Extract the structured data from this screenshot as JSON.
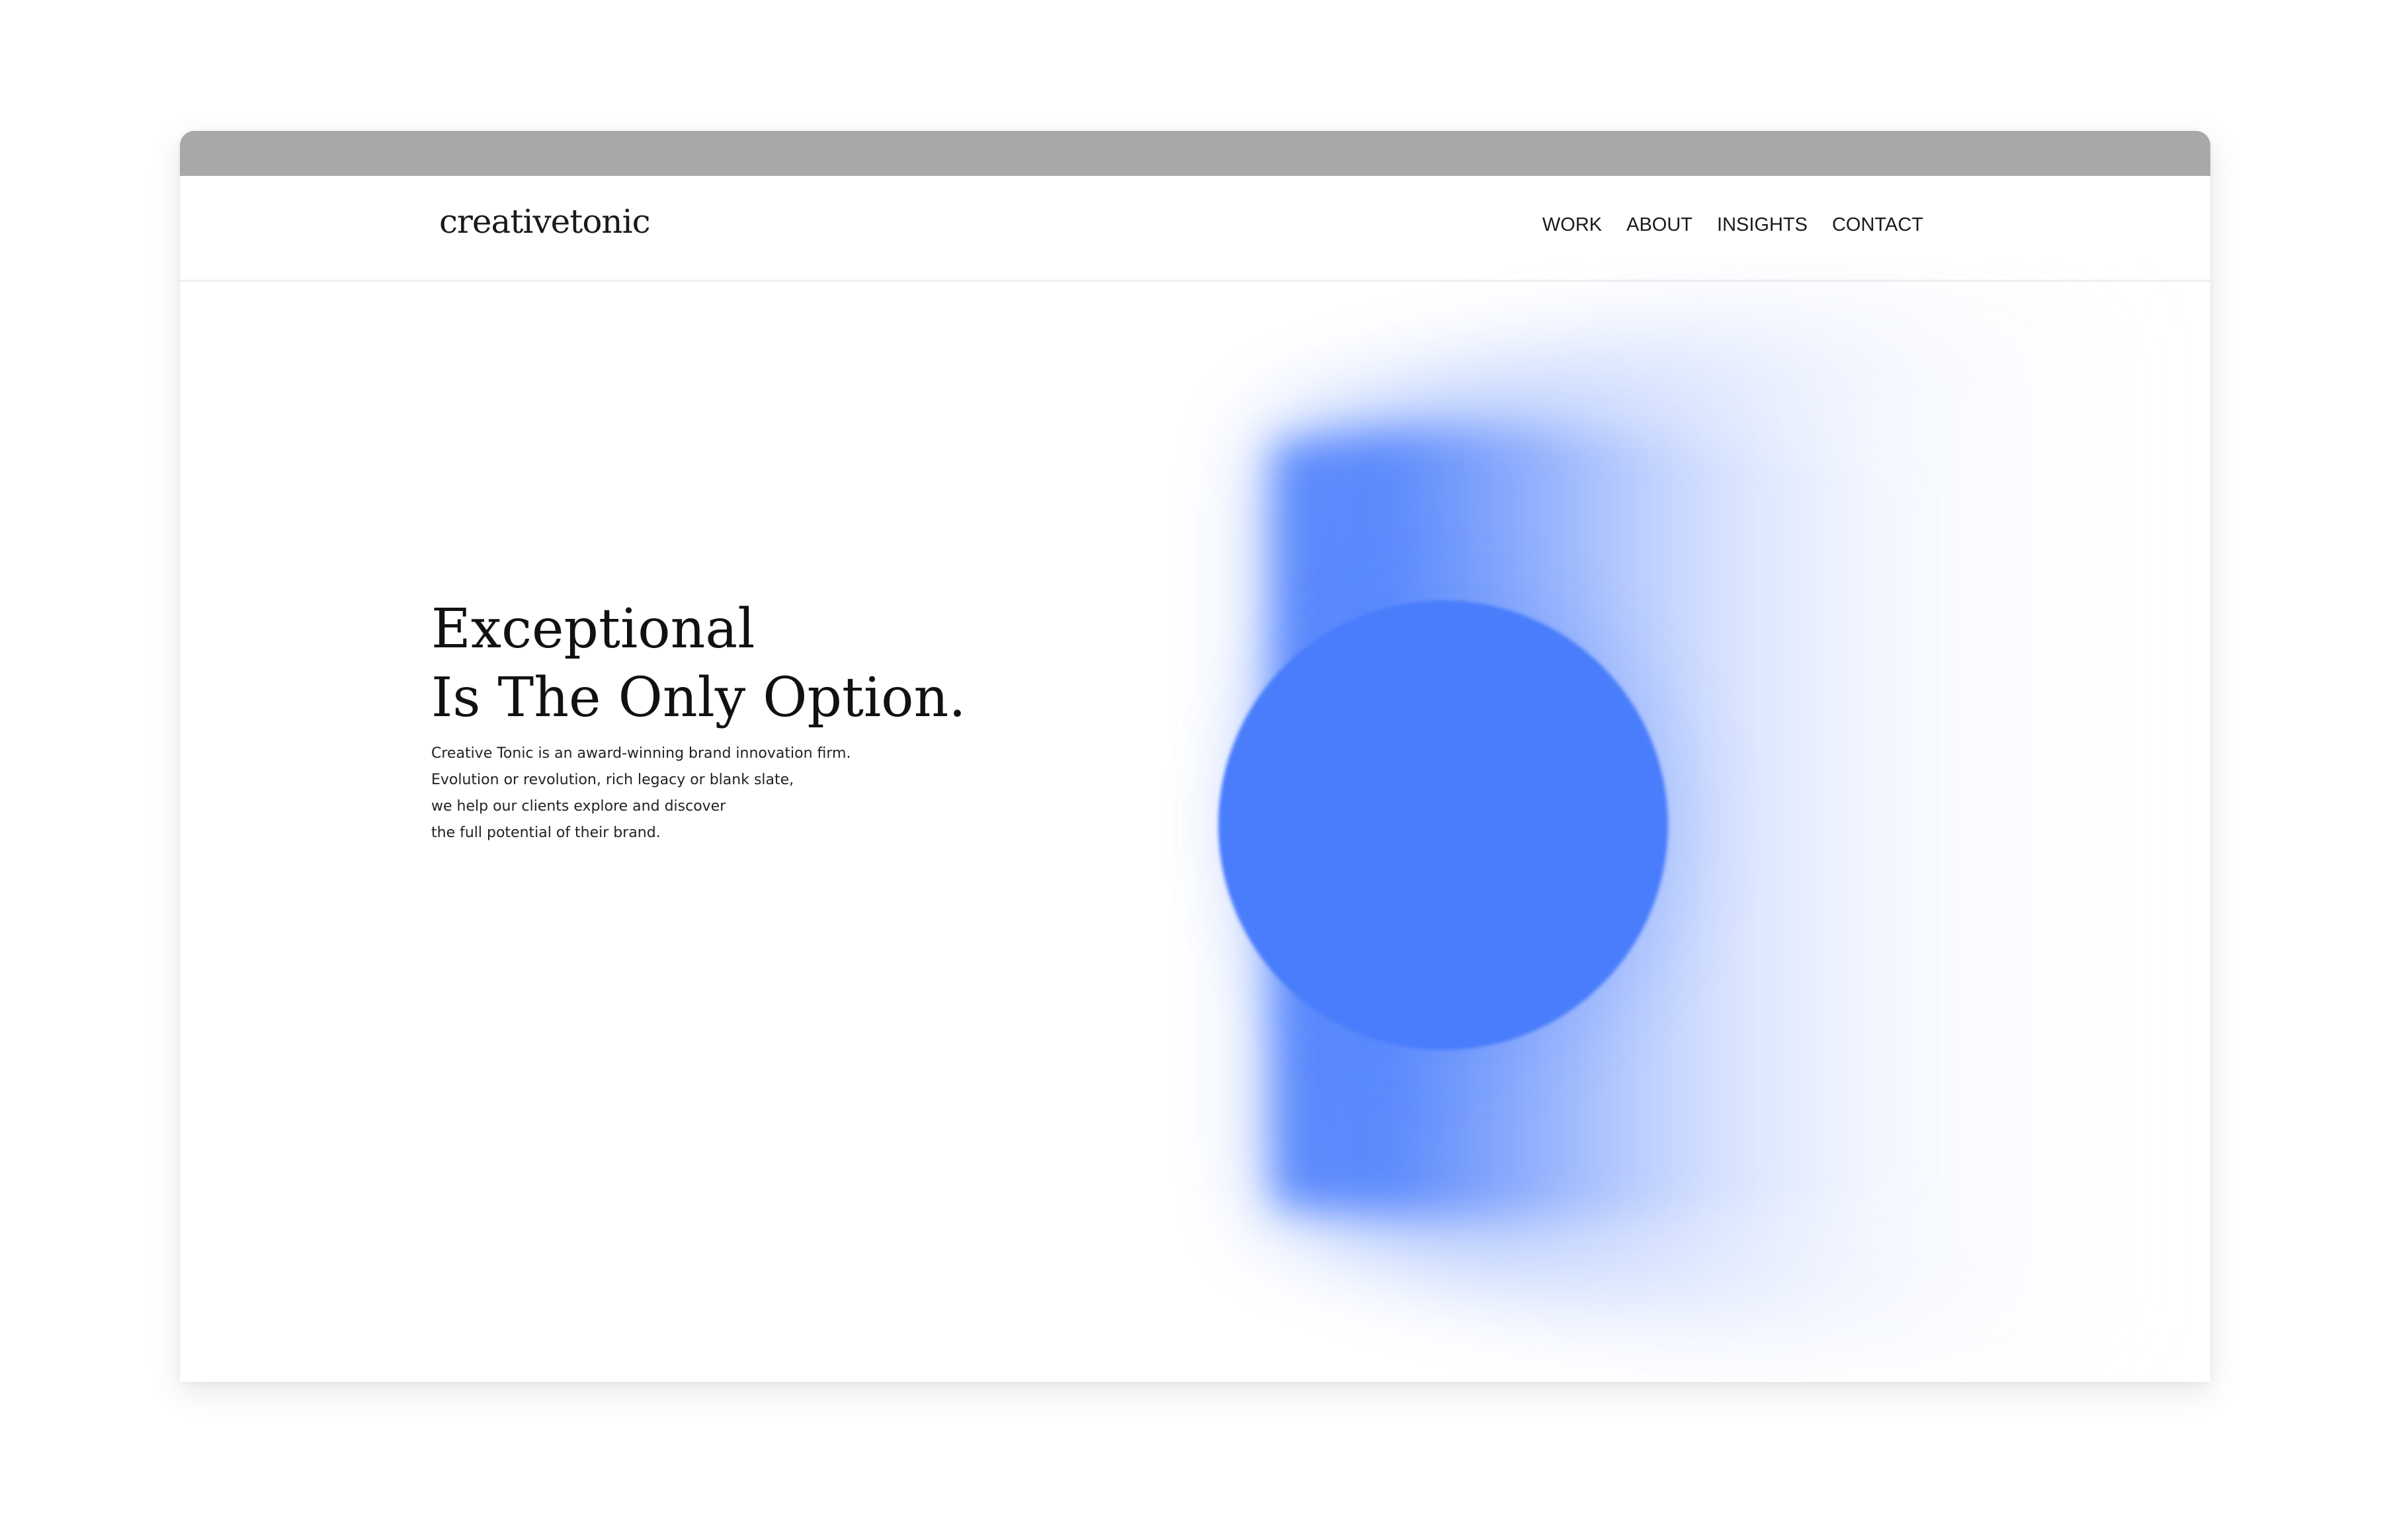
{
  "brand": {
    "logo": "creativetonic"
  },
  "nav": {
    "items": [
      "WORK",
      "ABOUT",
      "INSIGHTS",
      "CONTACT"
    ]
  },
  "hero": {
    "headline": [
      "Exceptional",
      "Is The Only Option."
    ],
    "body_lines": [
      "Creative Tonic is an award-winning brand innovation firm.",
      "Evolution or revolution, rich legacy or blank slate,",
      "we help our clients explore and discover",
      "the full potential of their brand."
    ]
  },
  "colors": {
    "accent": "#4a7dfc",
    "titlebar": "#a8a8a8",
    "text": "#111111"
  }
}
